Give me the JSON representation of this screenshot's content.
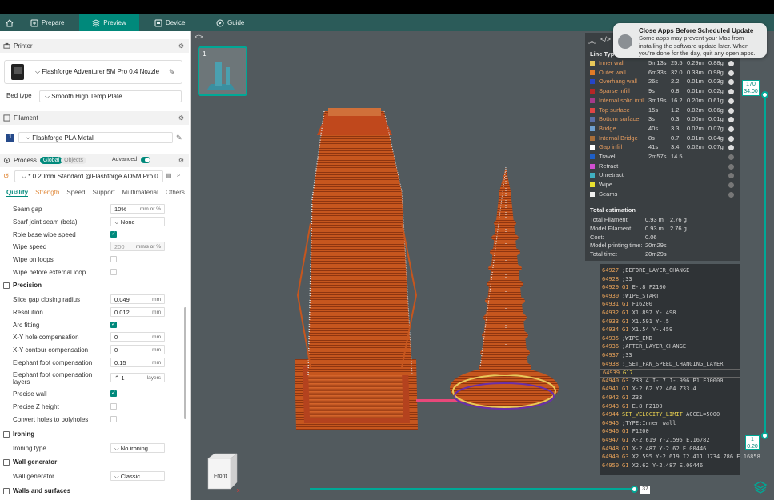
{
  "tabs": {
    "prepare": "Prepare",
    "preview": "Preview",
    "device": "Device",
    "guide": "Guide"
  },
  "printer": {
    "section": "Printer",
    "name": "Flashforge Adventurer 5M Pro 0.4 Nozzle",
    "bed_label": "Bed type",
    "bed_value": "Smooth High Temp Plate"
  },
  "filament": {
    "section": "Filament",
    "index": "1",
    "name": "Flashforge PLA Metal"
  },
  "process": {
    "section": "Process",
    "global": "Global",
    "objects": "Objects",
    "advanced": "Advanced",
    "profile": "* 0.20mm Standard @Flashforge AD5M Pro 0..."
  },
  "quality_tabs": [
    "Quality",
    "Strength",
    "Speed",
    "Support",
    "Multimaterial",
    "Others"
  ],
  "params": {
    "seam_gap": {
      "label": "Seam gap",
      "value": "10%",
      "unit": "mm or %"
    },
    "scarf": {
      "label": "Scarf joint seam (beta)",
      "value": "None"
    },
    "role_wipe": {
      "label": "Role base wipe speed"
    },
    "wipe_speed": {
      "label": "Wipe speed",
      "value": "200",
      "unit": "mm/s or %"
    },
    "wipe_loops": {
      "label": "Wipe on loops"
    },
    "wipe_ext": {
      "label": "Wipe before external loop"
    },
    "precision": "Precision",
    "slice_gap": {
      "label": "Slice gap closing radius",
      "value": "0.049",
      "unit": "mm"
    },
    "resolution": {
      "label": "Resolution",
      "value": "0.012",
      "unit": "mm"
    },
    "arc": {
      "label": "Arc fitting"
    },
    "xy_hole": {
      "label": "X-Y hole compensation",
      "value": "0",
      "unit": "mm"
    },
    "xy_contour": {
      "label": "X-Y contour compensation",
      "value": "0",
      "unit": "mm"
    },
    "elephant": {
      "label": "Elephant foot compensation",
      "value": "0.15",
      "unit": "mm"
    },
    "elephant_layers": {
      "label": "Elephant foot compensation layers",
      "value": "1",
      "unit": "layers"
    },
    "precise_wall": {
      "label": "Precise wall"
    },
    "precise_z": {
      "label": "Precise Z height"
    },
    "holes_poly": {
      "label": "Convert holes to polyholes"
    },
    "ironing": "Ironing",
    "ironing_type": {
      "label": "Ironing type",
      "value": "No ironing"
    },
    "wall_gen_group": "Wall generator",
    "wall_gen": {
      "label": "Wall generator",
      "value": "Classic"
    },
    "walls_surfaces": "Walls and surfaces"
  },
  "thumb_number": "1",
  "legend": {
    "header": "Line Type",
    "rows": [
      {
        "name": "Inner wall",
        "time": "5m13s",
        "pct": "25.5",
        "len": "0.29m",
        "wt": "0.88g",
        "color": "#e8c85a"
      },
      {
        "name": "Outer wall",
        "time": "6m33s",
        "pct": "32.0",
        "len": "0.33m",
        "wt": "0.98g",
        "color": "#e07b27"
      },
      {
        "name": "Overhang wall",
        "time": "26s",
        "pct": "2.2",
        "len": "0.01m",
        "wt": "0.03g",
        "color": "#2545c8"
      },
      {
        "name": "Sparse infill",
        "time": "9s",
        "pct": "0.8",
        "len": "0.01m",
        "wt": "0.02g",
        "color": "#b52626"
      },
      {
        "name": "Internal solid infill",
        "time": "3m19s",
        "pct": "16.2",
        "len": "0.20m",
        "wt": "0.61g",
        "color": "#a63a8a"
      },
      {
        "name": "Top surface",
        "time": "15s",
        "pct": "1.2",
        "len": "0.02m",
        "wt": "0.06g",
        "color": "#e04545"
      },
      {
        "name": "Bottom surface",
        "time": "3s",
        "pct": "0.3",
        "len": "0.00m",
        "wt": "0.01g",
        "color": "#5a6fa8"
      },
      {
        "name": "Bridge",
        "time": "40s",
        "pct": "3.3",
        "len": "0.02m",
        "wt": "0.07g",
        "color": "#6fa0d0"
      },
      {
        "name": "Internal Bridge",
        "time": "8s",
        "pct": "0.7",
        "len": "0.01m",
        "wt": "0.04g",
        "color": "#a86f3a"
      },
      {
        "name": "Gap infill",
        "time": "41s",
        "pct": "3.4",
        "len": "0.02m",
        "wt": "0.07g",
        "color": "#ffffff"
      },
      {
        "name": "Travel",
        "time": "2m57s",
        "pct": "14.5",
        "len": "",
        "wt": "",
        "color": "#1e5fc8"
      },
      {
        "name": "Retract",
        "time": "",
        "pct": "",
        "len": "",
        "wt": "",
        "color": "#d04fd0"
      },
      {
        "name": "Unretract",
        "time": "",
        "pct": "",
        "len": "",
        "wt": "",
        "color": "#40b0c0"
      },
      {
        "name": "Wipe",
        "time": "",
        "pct": "",
        "len": "",
        "wt": "",
        "color": "#e8e030"
      },
      {
        "name": "Seams",
        "time": "",
        "pct": "",
        "len": "",
        "wt": "",
        "color": "#f0f0f0"
      }
    ],
    "total_header": "Total estimation",
    "totals": [
      {
        "label": "Total Filament:",
        "v1": "0.93 m",
        "v2": "2.76 g"
      },
      {
        "label": "Model Filament:",
        "v1": "0.93 m",
        "v2": "2.76 g"
      },
      {
        "label": "Cost:",
        "v1": "0.06",
        "v2": ""
      },
      {
        "label": "Model printing time:",
        "v1": "20m29s",
        "v2": ""
      },
      {
        "label": "Total time:",
        "v1": "20m29s",
        "v2": ""
      }
    ]
  },
  "notification": {
    "title": "Close Apps Before Scheduled Update",
    "body": "Some apps may prevent your Mac from installing the software update later. When you're done for the day, quit any open apps."
  },
  "gcode": [
    {
      "n": "64927",
      "c": ";BEFORE_LAYER_CHANGE"
    },
    {
      "n": "64928",
      "c": ";33"
    },
    {
      "n": "64929",
      "k": "G1",
      "c": " E-.8 F2100"
    },
    {
      "n": "64930",
      "c": ";WIPE_START"
    },
    {
      "n": "64931",
      "k": "G1",
      "c": " F16200"
    },
    {
      "n": "64932",
      "k": "G1",
      "c": " X1.897 Y-.498"
    },
    {
      "n": "64933",
      "k": "G1",
      "c": " X1.591 Y-.5"
    },
    {
      "n": "64934",
      "k": "G1",
      "c": " X1.54 Y-.459"
    },
    {
      "n": "64935",
      "c": ";WIPE_END"
    },
    {
      "n": "64936",
      "c": ";AFTER_LAYER_CHANGE"
    },
    {
      "n": "64937",
      "c": ";33"
    },
    {
      "n": "64938",
      "c": ";_SET_FAN_SPEED_CHANGING_LAYER"
    },
    {
      "n": "64939",
      "k": "G17",
      "c": ""
    },
    {
      "n": "64940",
      "k": "G3",
      "c": " Z33.4 I-.7 J-.996 P1 F30000"
    },
    {
      "n": "64941",
      "k": "G1",
      "c": " X-2.62 Y2.464 Z33.4"
    },
    {
      "n": "64942",
      "k": "G1",
      "c": " Z33"
    },
    {
      "n": "64943",
      "k": "G1",
      "c": " E.8 F2100"
    },
    {
      "n": "64944",
      "k": "SET_VELOCITY_LIMIT",
      "c": " ACCEL=5000"
    },
    {
      "n": "64945",
      "c": ";TYPE:Inner wall"
    },
    {
      "n": "64946",
      "k": "G1",
      "c": " F1200"
    },
    {
      "n": "64947",
      "k": "G1",
      "c": " X-2.619 Y-2.595 E.16782"
    },
    {
      "n": "64948",
      "k": "G1",
      "c": " X-2.487 Y-2.62 E.00446"
    },
    {
      "n": "64949",
      "k": "G3",
      "c": " X2.595 Y-2.619 I2.411 J734.786 E.16858"
    },
    {
      "n": "64950",
      "k": "G1",
      "c": " X2.62 Y-2.487 E.00446"
    }
  ],
  "layer_slider": {
    "top_layer": "170",
    "top_z": "34.00",
    "bottom_layer": "1",
    "bottom_z": "0.20"
  },
  "move_slider_value": "37",
  "view_cube_label": "Front"
}
